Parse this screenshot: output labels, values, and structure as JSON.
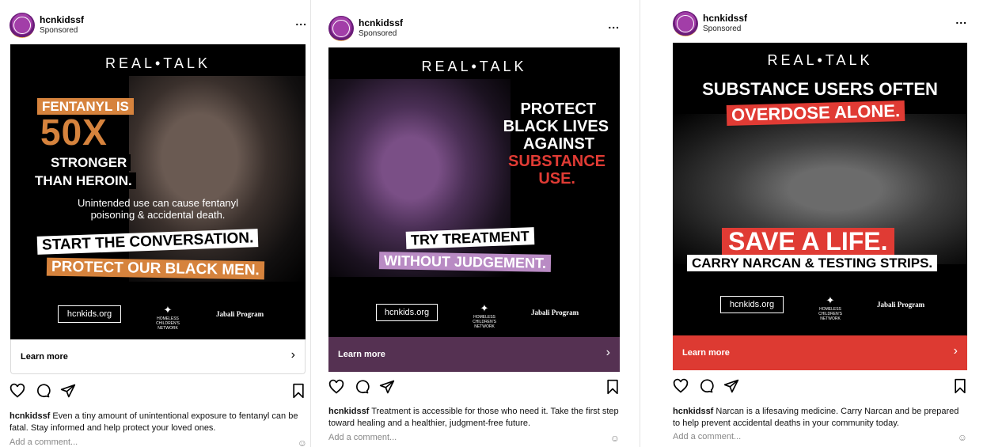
{
  "posts": [
    {
      "username": "hcnkidssf",
      "sponsored": "Sponsored",
      "more": "...",
      "ad": {
        "brand": "REAL•TALK",
        "lines": [
          "FENTANYL IS",
          "50X",
          "STRONGER",
          "THAN HEROIN."
        ],
        "subtext": [
          "Unintended use can cause fentanyl",
          "poisoning & accidental death."
        ],
        "cta_lines": [
          "START THE CONVERSATION.",
          "PROTECT OUR BLACK MEN."
        ],
        "logo_url": "hcnkids.org",
        "logo_network": "HOMELESS CHILDREN'S NETWORK",
        "logo_program": "Jabali Program"
      },
      "cta_label": "Learn more",
      "caption_user": "hcnkidssf",
      "caption": "Even a tiny amount of unintentional exposure to fentanyl can be fatal. Stay informed and help protect your loved ones.",
      "comment_placeholder": "Add a comment...",
      "colors": {
        "cta_bg": "#ffffff",
        "cta_fg": "#000000"
      }
    },
    {
      "username": "hcnkidssf",
      "sponsored": "Sponsored",
      "more": "...",
      "ad": {
        "brand": "REAL•TALK",
        "lines": [
          "PROTECT",
          "BLACK LIVES",
          "AGAINST",
          "SUBSTANCE",
          "USE."
        ],
        "cta_lines": [
          "TRY TREATMENT",
          "WITHOUT JUDGEMENT."
        ],
        "logo_url": "hcnkids.org",
        "logo_network": "HOMELESS CHILDREN'S NETWORK",
        "logo_program": "Jabali Program"
      },
      "cta_label": "Learn more",
      "caption_user": "hcnkidssf",
      "caption": "Treatment is accessible for those who need it. Take the first step toward healing and a healthier, judgment-free future.",
      "comment_placeholder": "Add a comment...",
      "colors": {
        "cta_bg": "#553152",
        "cta_fg": "#ffffff"
      }
    },
    {
      "username": "hcnkidssf",
      "sponsored": "Sponsored",
      "more": "...",
      "ad": {
        "brand": "REAL•TALK",
        "lines": [
          "SUBSTANCE USERS OFTEN",
          "OVERDOSE ALONE."
        ],
        "cta_lines": [
          "SAVE A LIFE.",
          "CARRY NARCAN & TESTING STRIPS."
        ],
        "logo_url": "hcnkids.org",
        "logo_network": "HOMELESS CHILDREN'S NETWORK",
        "logo_program": "Jabali Program"
      },
      "cta_label": "Learn more",
      "caption_user": "hcnkidssf",
      "caption": "Narcan is a lifesaving medicine. Carry Narcan and be prepared to help prevent accidental deaths in your community today.",
      "comment_placeholder": "Add a comment...",
      "colors": {
        "cta_bg": "#dd3a32",
        "cta_fg": "#ffffff"
      }
    }
  ]
}
